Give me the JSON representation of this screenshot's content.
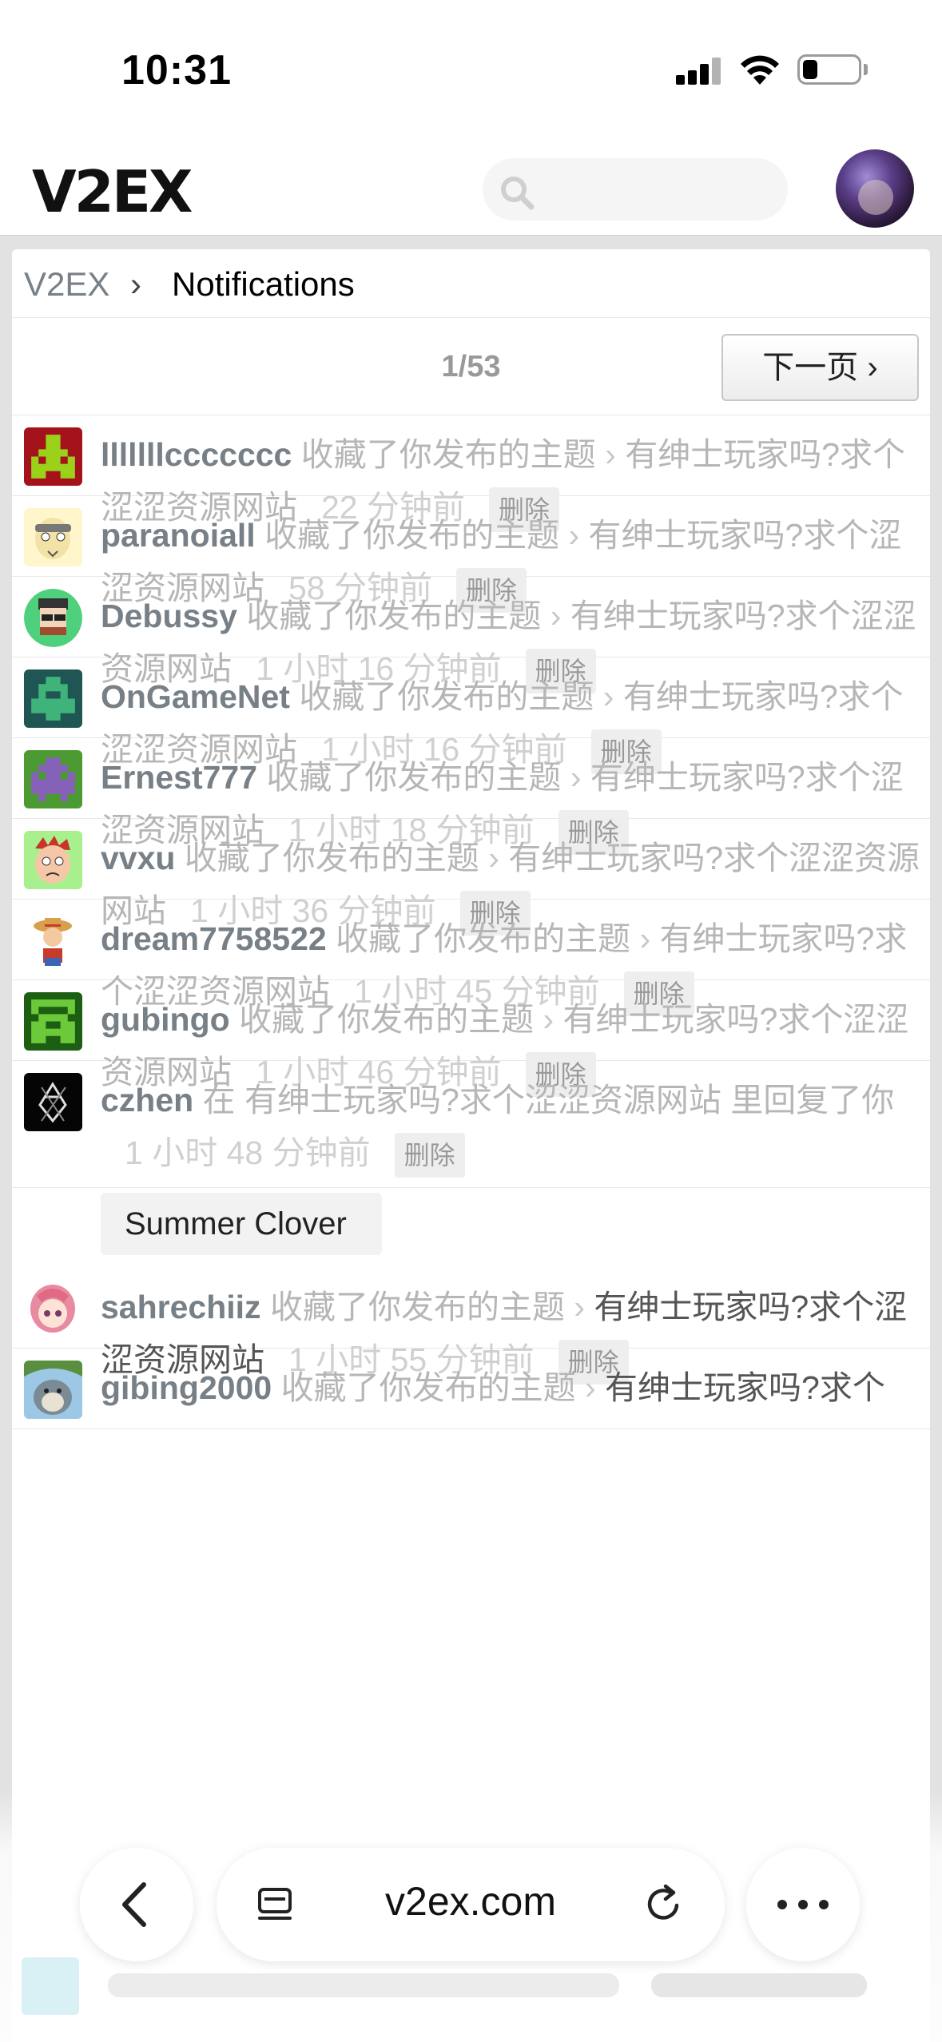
{
  "status_bar": {
    "time": "10:31"
  },
  "header": {
    "logo": "V2EX",
    "search_placeholder": ""
  },
  "breadcrumb": {
    "home": "V2EX",
    "separator": "›",
    "current": "Notifications"
  },
  "pager": {
    "page": "1/53",
    "next_label": "下一页 ›"
  },
  "notifications": [
    {
      "user": "lllllllccccccc",
      "action": "收藏了你发布的主题",
      "sep": "›",
      "topic": "有绅士玩家吗?求个涩涩资源网站",
      "time": "22 分钟前",
      "delete": "删除"
    },
    {
      "user": "paranoiall",
      "action": "收藏了你发布的主题",
      "sep": "›",
      "topic": "有绅士玩家吗?求个涩涩资源网站",
      "time": "58 分钟前",
      "delete": "删除"
    },
    {
      "user": "Debussy",
      "action": "收藏了你发布的主题",
      "sep": "›",
      "topic": "有绅士玩家吗?求个涩涩资源网站",
      "time": "1 小时 16 分钟前",
      "delete": "删除"
    },
    {
      "user": "OnGameNet",
      "action": "收藏了你发布的主题",
      "sep": "›",
      "topic": "有绅士玩家吗?求个涩涩资源网站",
      "time": "1 小时 16 分钟前",
      "delete": "删除"
    },
    {
      "user": "Ernest777",
      "action": "收藏了你发布的主题",
      "sep": "›",
      "topic": "有绅士玩家吗?求个涩涩资源网站",
      "time": "1 小时 18 分钟前",
      "delete": "删除"
    },
    {
      "user": "vvxu",
      "action": "收藏了你发布的主题",
      "sep": "›",
      "topic": "有绅士玩家吗?求个涩涩资源网站",
      "time": "1 小时 36 分钟前",
      "delete": "删除"
    },
    {
      "user": "dream7758522",
      "action": "收藏了你发布的主题",
      "sep": "›",
      "topic": "有绅士玩家吗?求个涩涩资源网站",
      "time": "1 小时 45 分钟前",
      "delete": "删除"
    },
    {
      "user": "gubingo",
      "action": "收藏了你发布的主题",
      "sep": "›",
      "topic": "有绅士玩家吗?求个涩涩资源网站",
      "time": "1 小时 46 分钟前",
      "delete": "删除"
    },
    {
      "user": "czhen",
      "pre": "在",
      "topic": "有绅士玩家吗?求个涩涩资源网站",
      "post": "里回复了你",
      "time": "1 小时 48 分钟前",
      "delete": "删除",
      "reply": "Summer Clover"
    },
    {
      "user": "sahrechiiz",
      "action": "收藏了你发布的主题",
      "sep": "›",
      "topic": "有绅士玩家吗?求个涩涩资源网站",
      "time": "1 小时 55 分钟前",
      "delete": "删除"
    },
    {
      "user": "gibing2000",
      "action": "收藏了你发布的主题",
      "sep": "›",
      "topic": "有绅士玩家吗?求个"
    }
  ],
  "toolbar": {
    "url": "v2ex.com"
  },
  "colors": {
    "username": "#778087",
    "muted": "#b6b6b6",
    "time": "#d0d0d0",
    "background": "#e2e2e2"
  }
}
